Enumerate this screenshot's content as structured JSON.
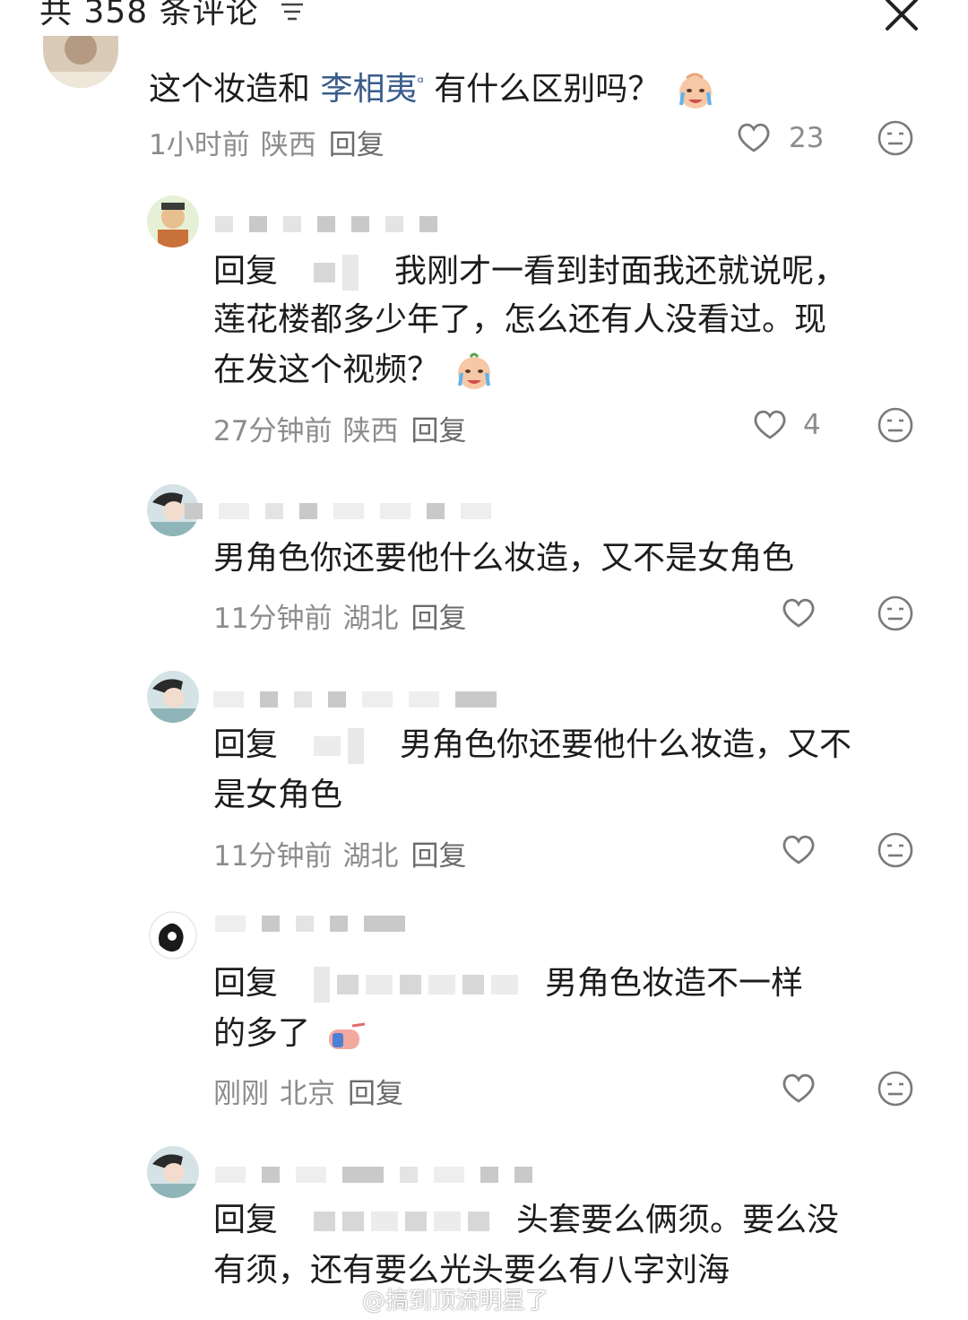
{
  "header": {
    "title": "共 358 条评论"
  },
  "comments": [
    {
      "text_before": "这个妆造和 ",
      "mention": "李相夷",
      "text_after": " 有什么区别吗？",
      "time": "1小时前",
      "location": "陕西",
      "reply_label": "回复",
      "likes": "23"
    },
    {
      "reply_prefix": "回复",
      "text_line1": "我刚才一看到封面我还就说呢，",
      "text_line2": "莲花楼都多少年了，怎么还有人没看过。现",
      "text_line3": "在发这个视频？",
      "time": "27分钟前",
      "location": "陕西",
      "reply_label": "回复",
      "likes": "4"
    },
    {
      "text": "男角色你还要他什么妆造，又不是女角色",
      "time": "11分钟前",
      "location": "湖北",
      "reply_label": "回复",
      "likes": ""
    },
    {
      "reply_prefix": "回复",
      "text_line1": "男角色你还要他什么妆造，又不",
      "text_line2": "是女角色",
      "time": "11分钟前",
      "location": "湖北",
      "reply_label": "回复",
      "likes": ""
    },
    {
      "reply_prefix": "回复",
      "text_line1": "男角色妆造不一样",
      "text_line2": "的多了",
      "time": "刚刚",
      "location": "北京",
      "reply_label": "回复",
      "likes": ""
    },
    {
      "reply_prefix": "回复",
      "text_line1": "头套要么俩须。要么没",
      "text_line2": "有须，还有要么光头要么有八字刘海"
    }
  ],
  "watermark": "@搞到顶流明星了",
  "colors": {
    "mention": "#3a5c8c",
    "meta": "#8c8c8c",
    "text": "#1c1c1c"
  },
  "icons": [
    "sort-icon",
    "close-icon",
    "heart-icon",
    "meh-face-icon",
    "crying-emoji-icon",
    "pointing-hand-emoji-icon"
  ]
}
